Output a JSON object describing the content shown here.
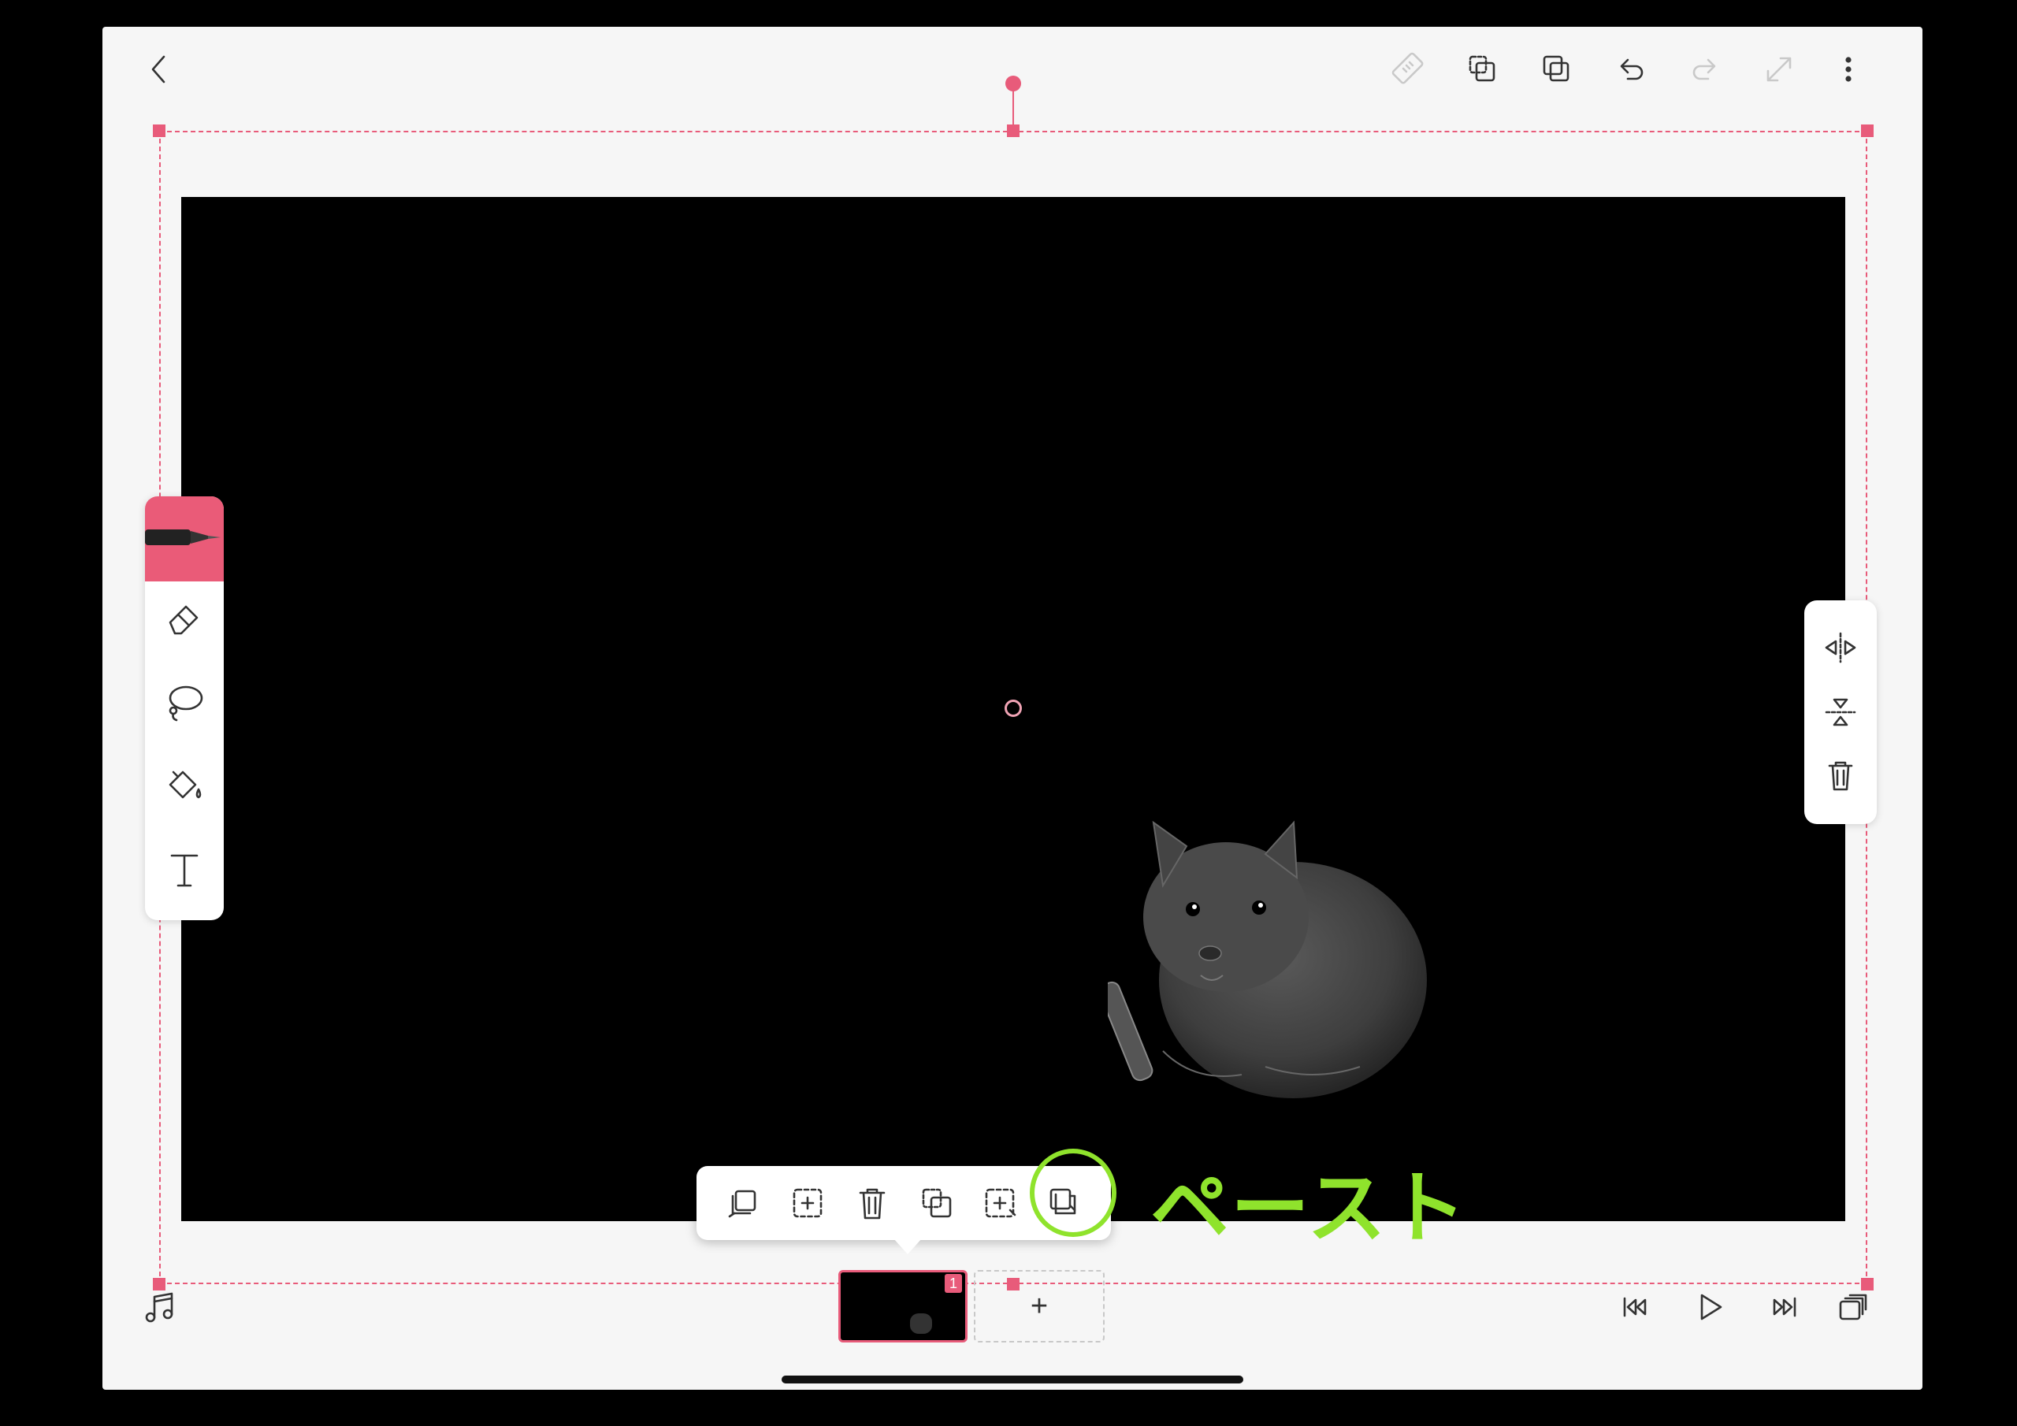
{
  "colors": {
    "accent": "#e85b7a",
    "annotation": "#8fe32c",
    "canvas": "#000000",
    "app_bg": "#f6f6f6"
  },
  "top_bar": {
    "back": "chevron-left-icon",
    "actions": [
      {
        "name": "ruler-icon",
        "enabled": false
      },
      {
        "name": "copy-selection-icon",
        "enabled": true
      },
      {
        "name": "duplicate-layer-icon",
        "enabled": true
      },
      {
        "name": "undo-icon",
        "enabled": true
      },
      {
        "name": "redo-icon",
        "enabled": false
      },
      {
        "name": "resize-icon",
        "enabled": false
      },
      {
        "name": "more-vertical-icon",
        "enabled": true
      }
    ]
  },
  "left_tools": [
    "pen-tool-icon",
    "eraser-icon",
    "lasso-icon",
    "fill-bucket-icon",
    "text-tool-icon"
  ],
  "right_tools": [
    "flip-horizontal-icon",
    "flip-vertical-icon",
    "delete-icon"
  ],
  "context_menu": {
    "items": [
      "cut-icon",
      "copy-dashed-icon",
      "trash-icon",
      "duplicate-icon",
      "add-dashed-icon",
      "paste-icon"
    ]
  },
  "annotation": {
    "text": "ペースト"
  },
  "timeline": {
    "frame_badge": "1",
    "add_frame_label": "+",
    "left_icon": "music-note-icon",
    "controls": [
      "skip-start-icon",
      "play-icon",
      "skip-end-icon",
      "frames-icon"
    ]
  }
}
